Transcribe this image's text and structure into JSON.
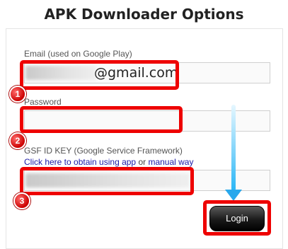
{
  "header": {
    "title": "APK Downloader Options"
  },
  "form": {
    "email_label": "Email (used on Google Play)",
    "email_value": "@gmail.com",
    "password_label": "Password",
    "gsf_label": "GSF ID KEY (Google Service Framework)",
    "gsf_link_app": "Click here to obtain using app",
    "gsf_link_or": " or ",
    "gsf_link_manual": "manual way",
    "login_label": "Login"
  },
  "annotations": {
    "badges": [
      "1",
      "2",
      "3"
    ],
    "highlight_color": "#ee0000",
    "arrow_color": "#29b6f6"
  }
}
